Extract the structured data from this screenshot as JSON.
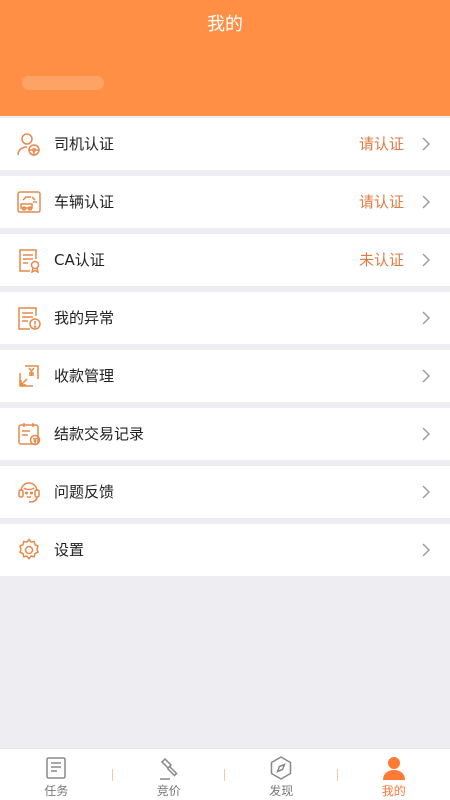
{
  "header": {
    "title": "我的"
  },
  "menu": [
    {
      "label": "司机认证",
      "status": "请认证",
      "icon": "driver-icon"
    },
    {
      "label": "车辆认证",
      "status": "请认证",
      "icon": "vehicle-icon"
    },
    {
      "label": "CA认证",
      "status": "未认证",
      "icon": "certificate-icon"
    },
    {
      "label": "我的异常",
      "status": "",
      "icon": "exception-icon"
    },
    {
      "label": "收款管理",
      "status": "",
      "icon": "payment-icon"
    },
    {
      "label": "结款交易记录",
      "status": "",
      "icon": "transaction-record-icon"
    },
    {
      "label": "问题反馈",
      "status": "",
      "icon": "feedback-icon"
    },
    {
      "label": "设置",
      "status": "",
      "icon": "settings-icon"
    }
  ],
  "tabs": [
    {
      "label": "任务",
      "icon": "task-icon",
      "active": false
    },
    {
      "label": "竞价",
      "icon": "auction-hammer-icon",
      "active": false
    },
    {
      "label": "发现",
      "icon": "compass-icon",
      "active": false
    },
    {
      "label": "我的",
      "icon": "user-icon",
      "active": true
    }
  ],
  "colors": {
    "accent": "#fe8f45",
    "status": "#e07b43",
    "background": "#eeeef2"
  }
}
